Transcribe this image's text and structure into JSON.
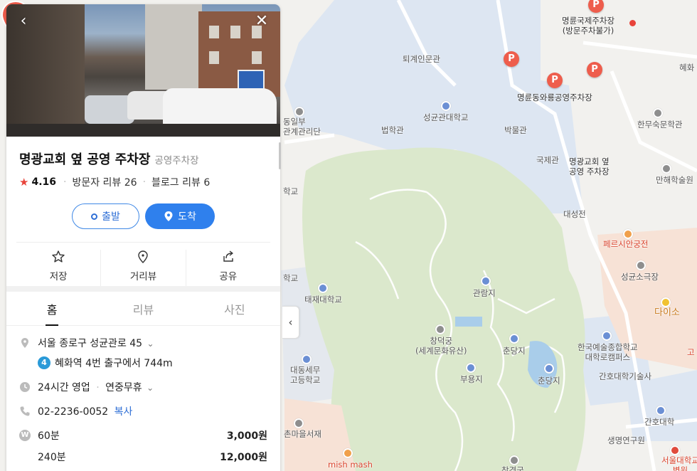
{
  "colors": {
    "accent": "#2f80ed",
    "rating_star": "#e8433a",
    "parking_pin": "#ee5d4c",
    "park_green": "#dbe8cc",
    "campus_blue": "#dde6f2"
  },
  "place": {
    "title": "명광교회 옆 공영 주차장",
    "category": "공영주차장",
    "rating": "4.16",
    "visitor_reviews": "방문자 리뷰 26",
    "blog_reviews": "블로그 리뷰 6"
  },
  "route": {
    "depart_label": "출발",
    "arrive_label": "도착"
  },
  "actions": [
    {
      "label": "저장",
      "icon": "star-icon"
    },
    {
      "label": "거리뷰",
      "icon": "location-pin-icon"
    },
    {
      "label": "공유",
      "icon": "share-icon"
    }
  ],
  "tabs": [
    {
      "label": "홈",
      "active": true
    },
    {
      "label": "리뷰",
      "active": false
    },
    {
      "label": "사진",
      "active": false
    }
  ],
  "info": {
    "address": "서울 종로구 성균관로 45",
    "subway_line": "4",
    "subway_text": "혜화역 4번 출구에서 744m",
    "hours": "24시간 영업",
    "hours_extra": "연중무휴",
    "phone": "02-2236-0052",
    "copy_label": "복사",
    "prices": [
      {
        "duration": "60분",
        "price": "3,000원"
      },
      {
        "duration": "240분",
        "price": "12,000원"
      }
    ]
  },
  "map": {
    "labels": {
      "myeongnyun_intl": "명륜국제주차장",
      "myeongnyun_intl_sub": "(방문주차불가)",
      "toegye": "퇴계인문관",
      "skku": "성균관대학교",
      "beophak": "법학관",
      "bakmul": "박물관",
      "myeongnyun_public": "명륜동와룡공영주차장",
      "gukje": "국제관",
      "selected_line1": "명광교회 옆",
      "selected_line2": "공영 주차장",
      "hanmusuk": "한무숙문학관",
      "manhae": "만해학술원",
      "daeseong": "대성전",
      "pepsi": "페르시안궁전",
      "sg_theater": "성균소극장",
      "daiso": "다이소",
      "gwallamji": "관람지",
      "changdeok1": "창덕궁",
      "changdeok2": "(세계문화유산)",
      "jundangji1": "춘당지",
      "jundangji2": "춘당지",
      "buyongji": "부용지",
      "karts1": "한국예술종합학교",
      "karts2": "대학로캠퍼스",
      "nursing_tech": "간호대학기술사",
      "taejae": "태재대학교",
      "daedong1": "대동세무",
      "daedong2": "고등학교",
      "nursing": "간호대학",
      "saengmyeong": "생명연구원",
      "snu_med1": "서울대학교",
      "snu_med2": "병원",
      "mishmash": "mish mash",
      "jaejae": "촌마을서재",
      "dongilbu1": "동일부",
      "dongilbu2": "관계관리단",
      "hwa": "혜화",
      "go": "고",
      "hak1": "학교",
      "hak2": "학교",
      "changgyeong": "창경궁"
    }
  }
}
